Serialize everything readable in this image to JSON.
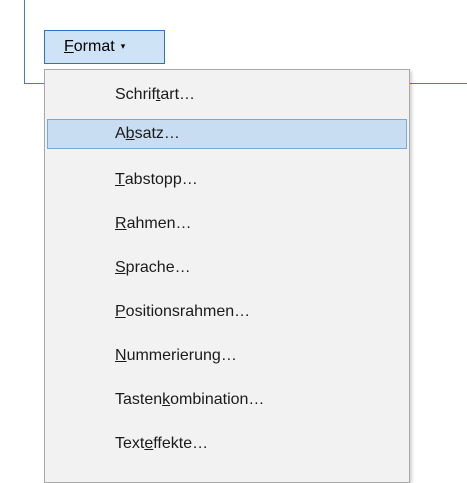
{
  "format_button": {
    "label_accel": "F",
    "label_rest": "ormat",
    "arrow": "▾"
  },
  "menu": {
    "items": [
      {
        "pre": "Schrif",
        "accel": "t",
        "post": "art…",
        "highlighted": false
      },
      {
        "pre": "A",
        "accel": "b",
        "post": "satz…",
        "highlighted": true
      },
      {
        "pre": "",
        "accel": "T",
        "post": "abstopp…",
        "highlighted": false
      },
      {
        "pre": "",
        "accel": "R",
        "post": "ahmen…",
        "highlighted": false
      },
      {
        "pre": "",
        "accel": "S",
        "post": "prache…",
        "highlighted": false
      },
      {
        "pre": "",
        "accel": "P",
        "post": "ositionsrahmen…",
        "highlighted": false
      },
      {
        "pre": "",
        "accel": "N",
        "post": "ummerierung…",
        "highlighted": false
      },
      {
        "pre": "Tasten",
        "accel": "k",
        "post": "ombination…",
        "highlighted": false
      },
      {
        "pre": "Text",
        "accel": "e",
        "post": "ffekte…",
        "highlighted": false
      }
    ]
  }
}
